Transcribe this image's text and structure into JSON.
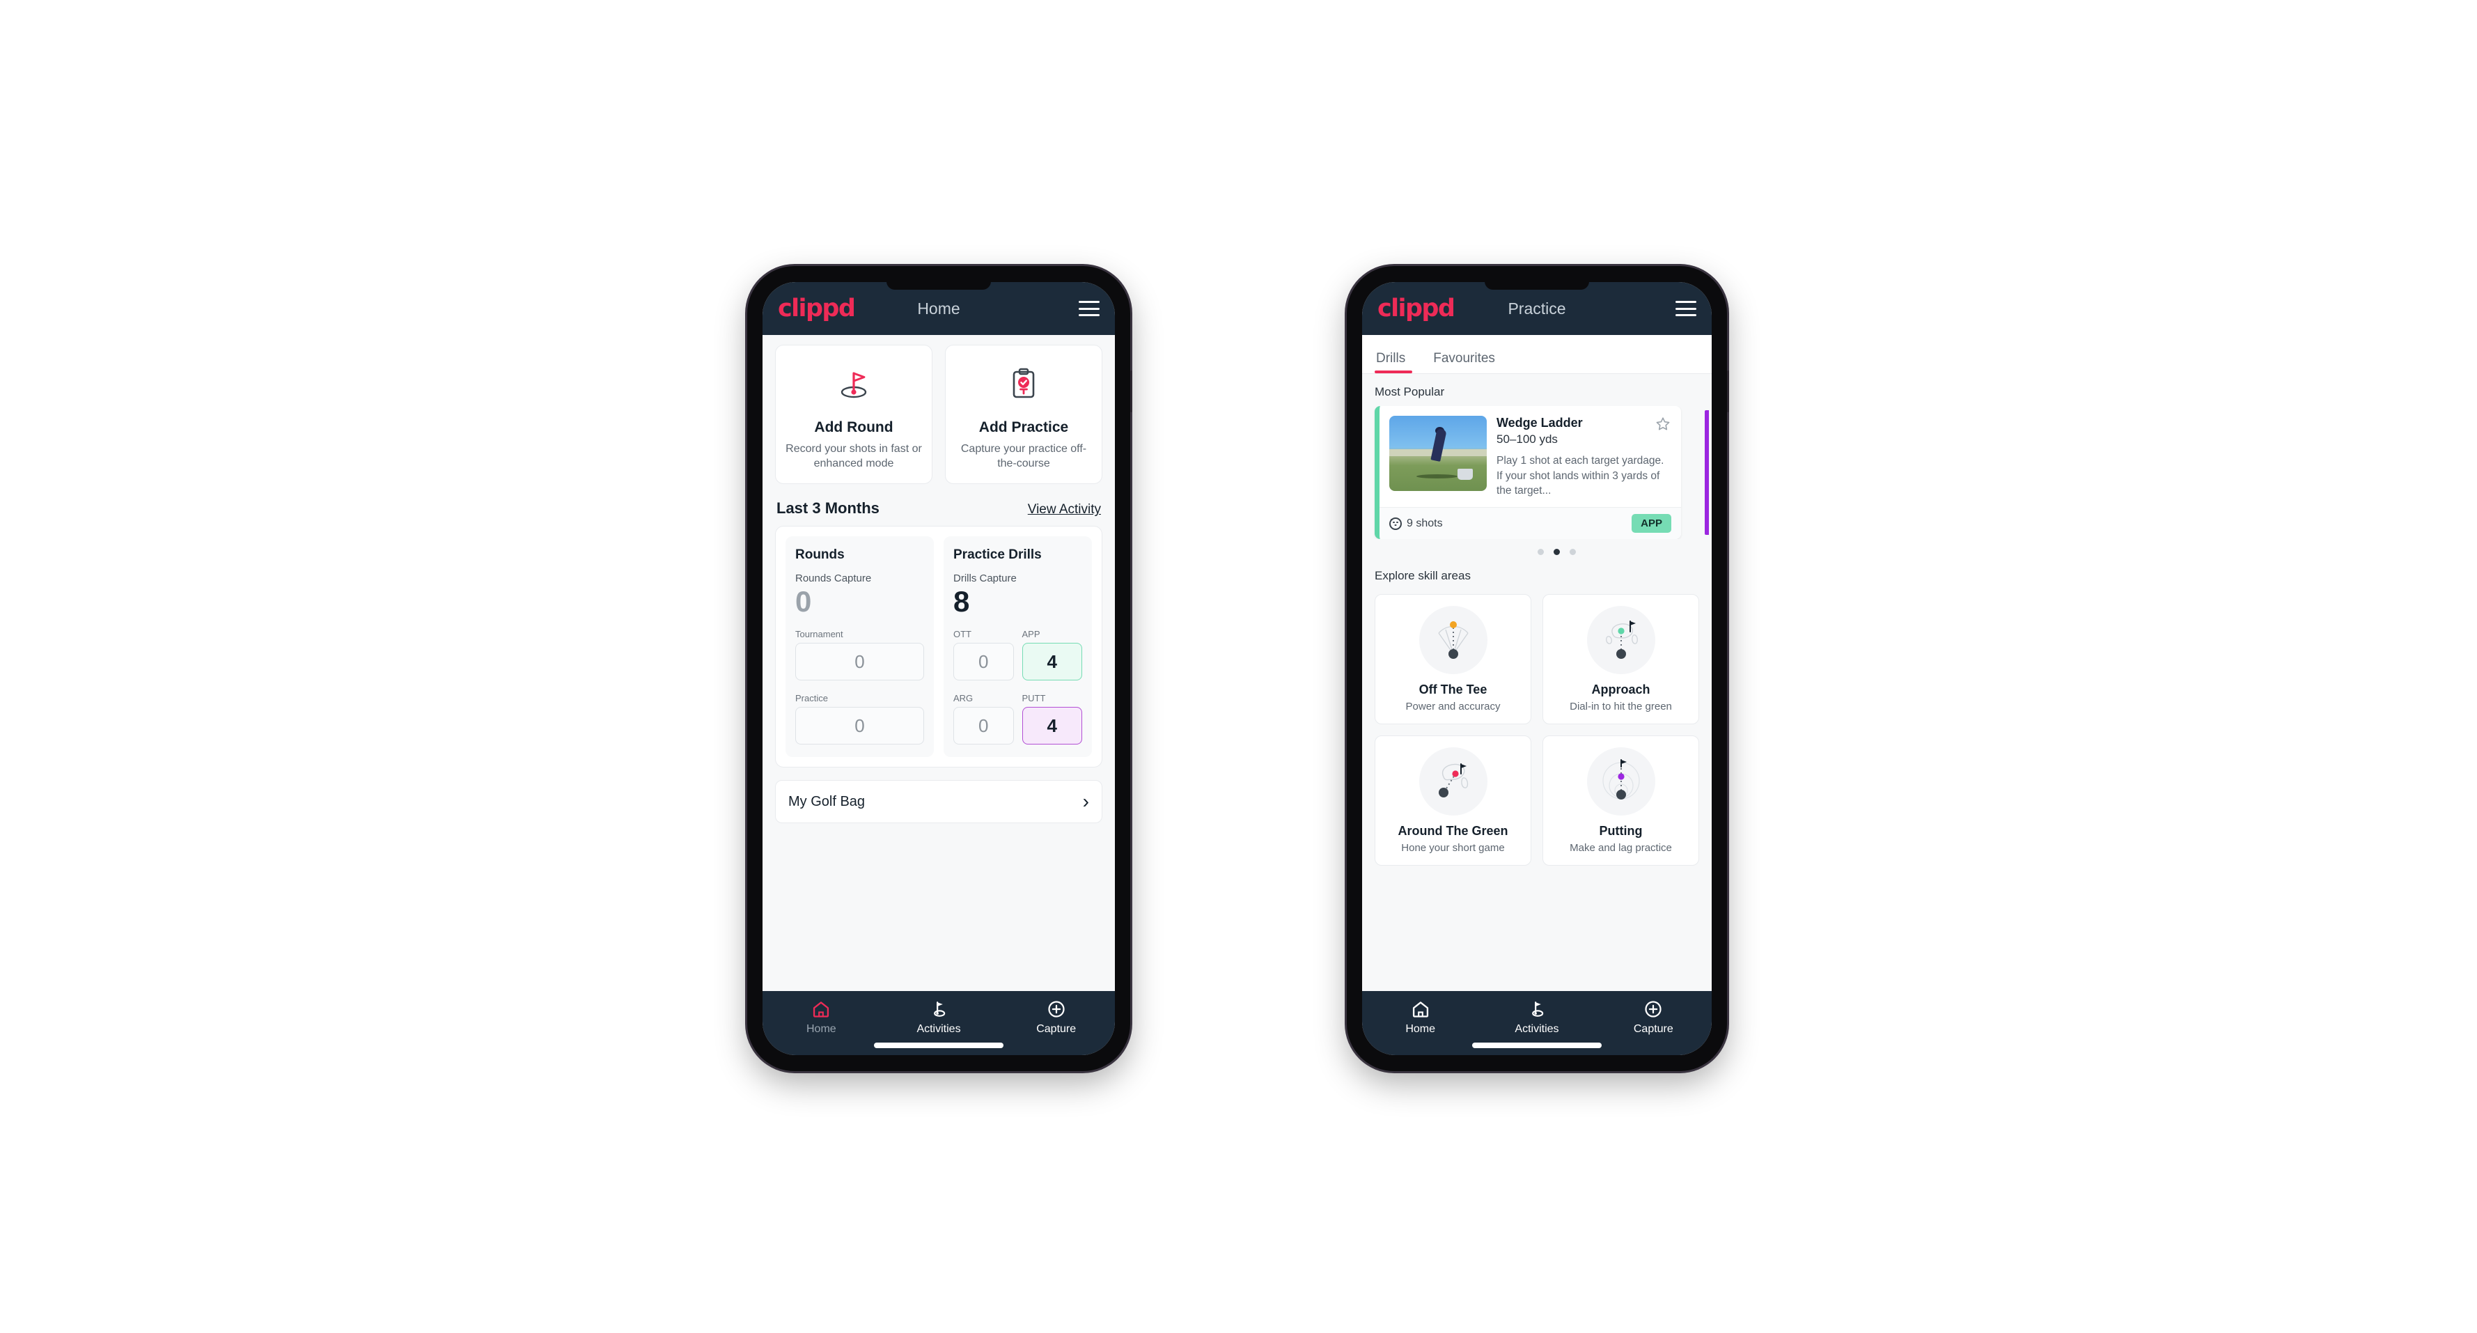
{
  "brand": {
    "name": "clippd",
    "accent": "#ee2b57",
    "appbar_bg": "#1c2b3a"
  },
  "phone1": {
    "appbar": {
      "title": "Home",
      "menu_icon": "hamburger-icon"
    },
    "quick_actions": [
      {
        "icon": "golf-flag-icon",
        "title": "Add Round",
        "subtitle": "Record your shots in fast or enhanced mode"
      },
      {
        "icon": "clipboard-check-icon",
        "title": "Add Practice",
        "subtitle": "Capture your practice off-the-course"
      }
    ],
    "section": {
      "title": "Last 3 Months",
      "link": "View Activity"
    },
    "rounds": {
      "title": "Rounds",
      "capture_label": "Rounds Capture",
      "capture_value": "0",
      "fields": [
        {
          "label": "Tournament",
          "value": "0",
          "state": "default"
        },
        {
          "label": "Practice",
          "value": "0",
          "state": "default"
        }
      ]
    },
    "drills": {
      "title": "Practice Drills",
      "capture_label": "Drills Capture",
      "capture_value": "8",
      "fields": [
        {
          "label": "OTT",
          "value": "0",
          "state": "default"
        },
        {
          "label": "APP",
          "value": "4",
          "state": "app"
        },
        {
          "label": "ARG",
          "value": "0",
          "state": "default"
        },
        {
          "label": "PUTT",
          "value": "4",
          "state": "putt"
        }
      ]
    },
    "golf_bag": {
      "label": "My Golf Bag",
      "chevron": "chevron-right-icon"
    },
    "bottom_nav": [
      {
        "label": "Home",
        "icon": "home-icon",
        "active": true
      },
      {
        "label": "Activities",
        "icon": "golf-flag-icon",
        "active": false
      },
      {
        "label": "Capture",
        "icon": "plus-circle-icon",
        "active": false
      }
    ]
  },
  "phone2": {
    "appbar": {
      "title": "Practice",
      "menu_icon": "hamburger-icon"
    },
    "tabs": [
      {
        "label": "Drills",
        "active": true
      },
      {
        "label": "Favourites",
        "active": false
      }
    ],
    "most_popular_label": "Most Popular",
    "drill_card": {
      "accent_color": "#5fd6a8",
      "title": "Wedge Ladder",
      "yardage": "50–100 yds",
      "description": "Play 1 shot at each target yardage. If your shot lands within 3 yards of the target...",
      "shots": "9 shots",
      "chip": "APP",
      "favourite_icon": "star-outline-icon",
      "shots_icon": "golf-ball-icon",
      "next_card_accent": "#9c27e0"
    },
    "carousel_dots": {
      "count": 3,
      "active_index": 1
    },
    "explore_label": "Explore skill areas",
    "skill_areas": [
      {
        "name": "Off The Tee",
        "subtitle": "Power and accuracy",
        "icon": "tee-fan-icon",
        "dot_color": "#f2a423"
      },
      {
        "name": "Approach",
        "subtitle": "Dial-in to hit the green",
        "icon": "green-approach-icon",
        "dot_color": "#5fd6a8"
      },
      {
        "name": "Around The Green",
        "subtitle": "Hone your short game",
        "icon": "chip-green-icon",
        "dot_color": "#ee2b57"
      },
      {
        "name": "Putting",
        "subtitle": "Make and lag practice",
        "icon": "putting-rings-icon",
        "dot_color": "#9c27e0"
      }
    ],
    "bottom_nav": [
      {
        "label": "Home",
        "icon": "home-icon",
        "active": false
      },
      {
        "label": "Activities",
        "icon": "golf-flag-icon",
        "active": true
      },
      {
        "label": "Capture",
        "icon": "plus-circle-icon",
        "active": false
      }
    ]
  }
}
